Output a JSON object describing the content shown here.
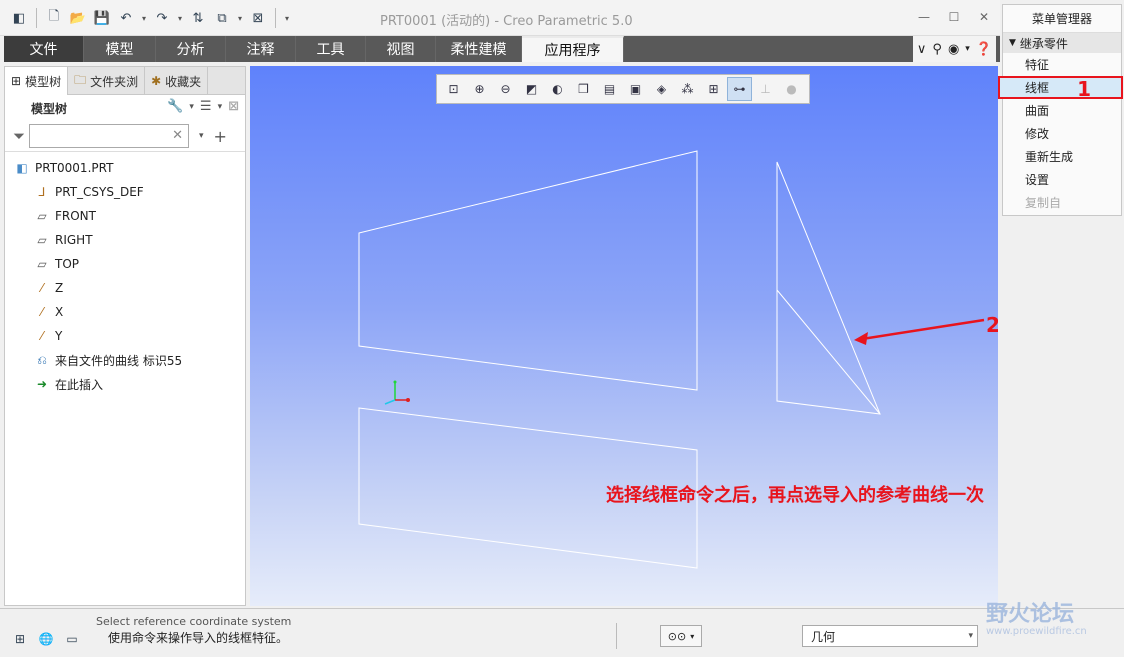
{
  "window": {
    "title": "PRT0001 (活动的) - Creo Parametric 5.0"
  },
  "ribbon": {
    "tabs": [
      "文件",
      "模型",
      "分析",
      "注释",
      "工具",
      "视图",
      "柔性建模",
      "应用程序"
    ],
    "active_tab": "应用程序"
  },
  "left_panel": {
    "tabs": [
      "模型树",
      "文件夹浏",
      "收藏夹"
    ],
    "header": "模型树",
    "filter_placeholder": "",
    "tree": [
      {
        "label": "PRT0001.PRT",
        "icon": "part-icon"
      },
      {
        "label": "PRT_CSYS_DEF",
        "icon": "csys-icon"
      },
      {
        "label": "FRONT",
        "icon": "datum-plane-icon"
      },
      {
        "label": "RIGHT",
        "icon": "datum-plane-icon"
      },
      {
        "label": "TOP",
        "icon": "datum-plane-icon"
      },
      {
        "label": "Z",
        "icon": "datum-axis-icon"
      },
      {
        "label": "X",
        "icon": "datum-axis-icon"
      },
      {
        "label": "Y",
        "icon": "datum-axis-icon"
      },
      {
        "label": "来自文件的曲线 标识55",
        "icon": "imported-curve-icon"
      },
      {
        "label": "在此插入",
        "icon": "insert-here-icon"
      }
    ]
  },
  "menu_manager": {
    "title": "菜单管理器",
    "section": "继承零件",
    "items": [
      "特征",
      "线框",
      "曲面",
      "修改",
      "重新生成",
      "设置",
      "复制自"
    ],
    "selected": "线框",
    "disabled": [
      "复制自"
    ],
    "callout_number": "1"
  },
  "viewport": {
    "callout_number": "2",
    "annotation": "选择线框命令之后，再点选导入的参考曲线一次"
  },
  "status_bar": {
    "message_previous": "Select reference coordinate system",
    "message_current": "使用命令来操作导入的线框特征。",
    "filter_value": "几何"
  },
  "watermark": {
    "text": "野火论坛",
    "url": "www.proewildfire.cn"
  },
  "colors": {
    "annotation_red": "#e8141d",
    "viewport_top": "#5f82fb",
    "viewport_bottom": "#e6ecfa",
    "selection_blue": "#d6e9f8"
  }
}
